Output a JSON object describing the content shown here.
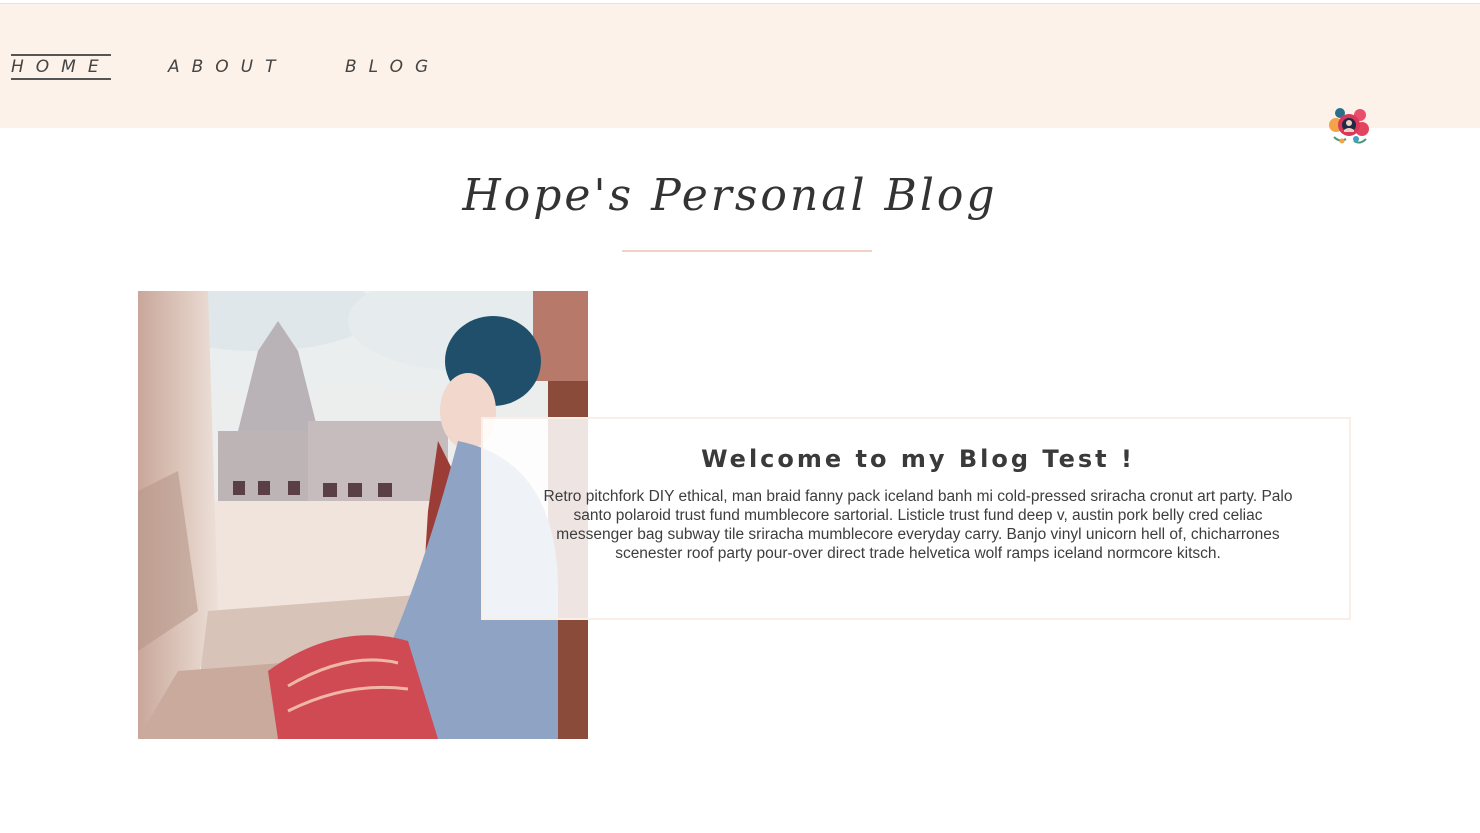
{
  "nav": {
    "items": [
      {
        "label": "HOME",
        "active": true
      },
      {
        "label": "ABOUT",
        "active": false
      },
      {
        "label": "BLOG",
        "active": false
      }
    ]
  },
  "header": {
    "title": "Hope's Personal Blog"
  },
  "welcome": {
    "heading": "Welcome to my Blog Test !",
    "body": "Retro pitchfork DIY ethical, man braid fanny pack iceland banh mi cold-pressed sriracha cronut art party. Palo santo polaroid trust fund mumblecore sartorial. Listicle trust fund deep v, austin pork belly cred celiac messenger bag subway tile sriracha mumblecore everyday carry. Banjo vinyl unicorn hell of, chicharrones scenester roof party pour-over direct trade helvetica wolf ramps iceland normcore kitsch."
  },
  "colors": {
    "nav_background": "#fdf2ea",
    "divider": "#f2d2c5",
    "text": "#3a3a3a"
  },
  "icons": {
    "avatar": "floral-avatar-icon"
  }
}
